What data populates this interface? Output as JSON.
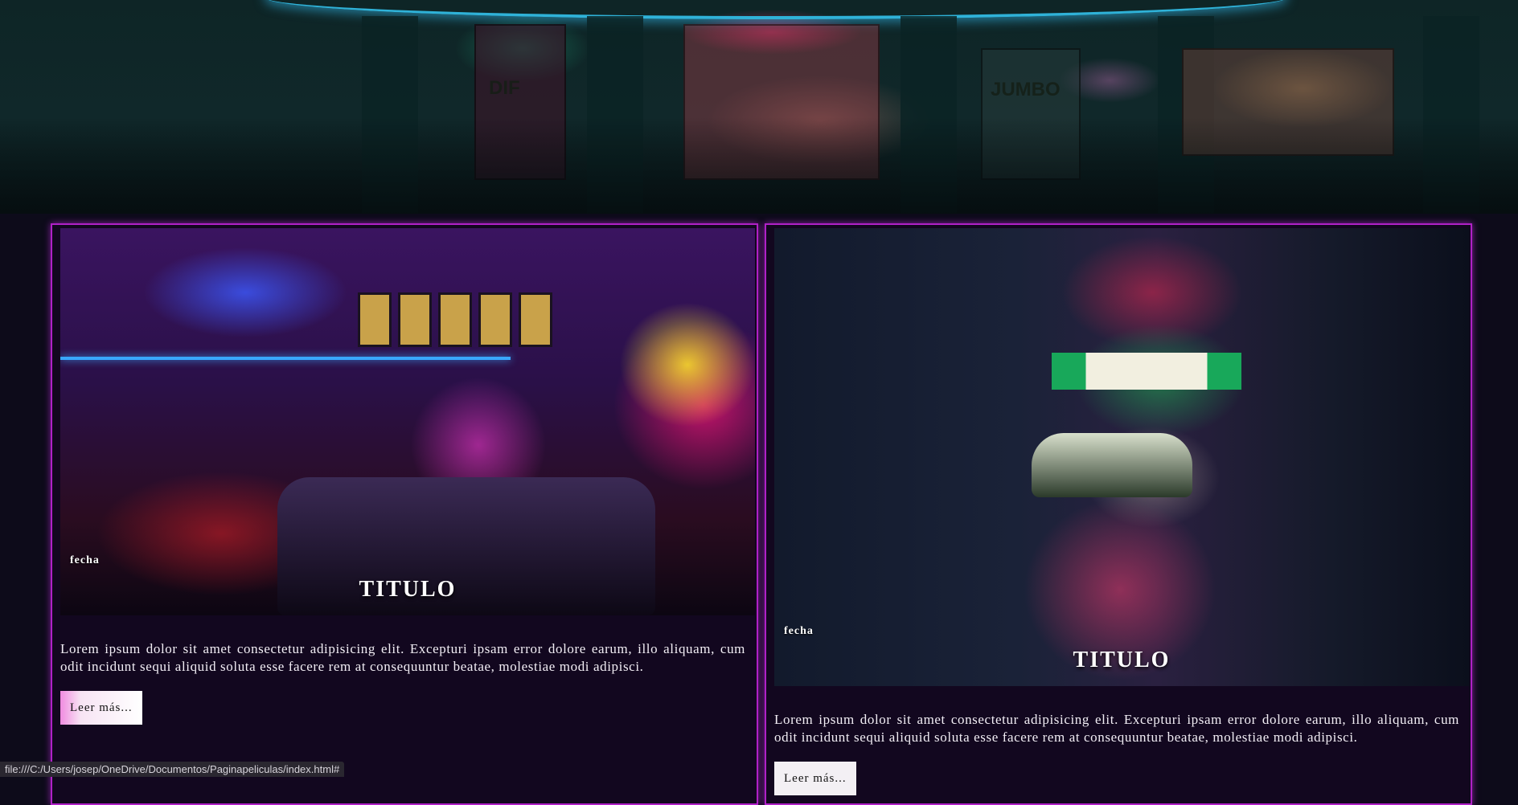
{
  "hero": {
    "signs": [
      "DIF",
      "JUMBO"
    ]
  },
  "cards": [
    {
      "date": "fecha",
      "title": "TITULO",
      "text": "Lorem ipsum dolor sit amet consectetur adipisicing elit. Excepturi ipsam error dolore earum, illo aliquam, cum odit incidunt sequi aliquid soluta esse facere rem at consequuntur beatae, molestiae modi adipisci.",
      "button": "Leer más..."
    },
    {
      "date": "fecha",
      "title": "TITULO",
      "text": "Lorem ipsum dolor sit amet consectetur adipisicing elit. Excepturi ipsam error dolore earum, illo aliquam, cum odit incidunt sequi aliquid soluta esse facere rem at consequuntur beatae, molestiae modi adipisci.",
      "button": "Leer más..."
    }
  ],
  "status": {
    "url": "file:///C:/Users/josep/OneDrive/Documentos/Paginapeliculas/index.html#"
  },
  "colors": {
    "background": "#0d0b1a",
    "card_border": "#b021c7",
    "card_background": "#12071f",
    "button_gradient_start": "#f08be0"
  }
}
